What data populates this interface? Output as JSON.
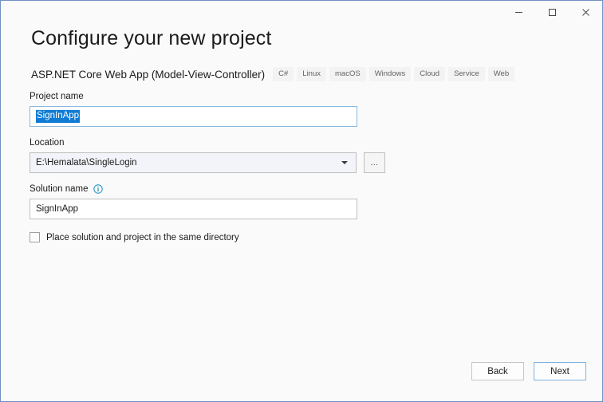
{
  "window": {
    "controls": [
      {
        "name": "minimize",
        "glyph": "minimize-icon"
      },
      {
        "name": "maximize",
        "glyph": "maximize-icon"
      },
      {
        "name": "close",
        "glyph": "close-icon"
      }
    ],
    "accent_color": "#6f8fc4",
    "background": "#fafafa"
  },
  "header": {
    "title": "Configure your new project",
    "template_name": "ASP.NET Core Web App (Model-View-Controller)",
    "tags": [
      "C#",
      "Linux",
      "macOS",
      "Windows",
      "Cloud",
      "Service",
      "Web"
    ]
  },
  "form": {
    "project_name": {
      "label": "Project name",
      "value": "SignInApp",
      "selected": true
    },
    "location": {
      "label": "Location",
      "value": "E:\\Hemalata\\SingleLogin",
      "browse_label": "...",
      "dropdown_icon": "chevron-down-icon"
    },
    "solution_name": {
      "label": "Solution name",
      "value": "SignInApp",
      "info_icon": "info-icon"
    },
    "same_directory": {
      "label": "Place solution and project in the same directory",
      "checked": false
    }
  },
  "footer": {
    "back_label": "Back",
    "next_label": "Next",
    "primary_accent": "#7db2e0"
  }
}
